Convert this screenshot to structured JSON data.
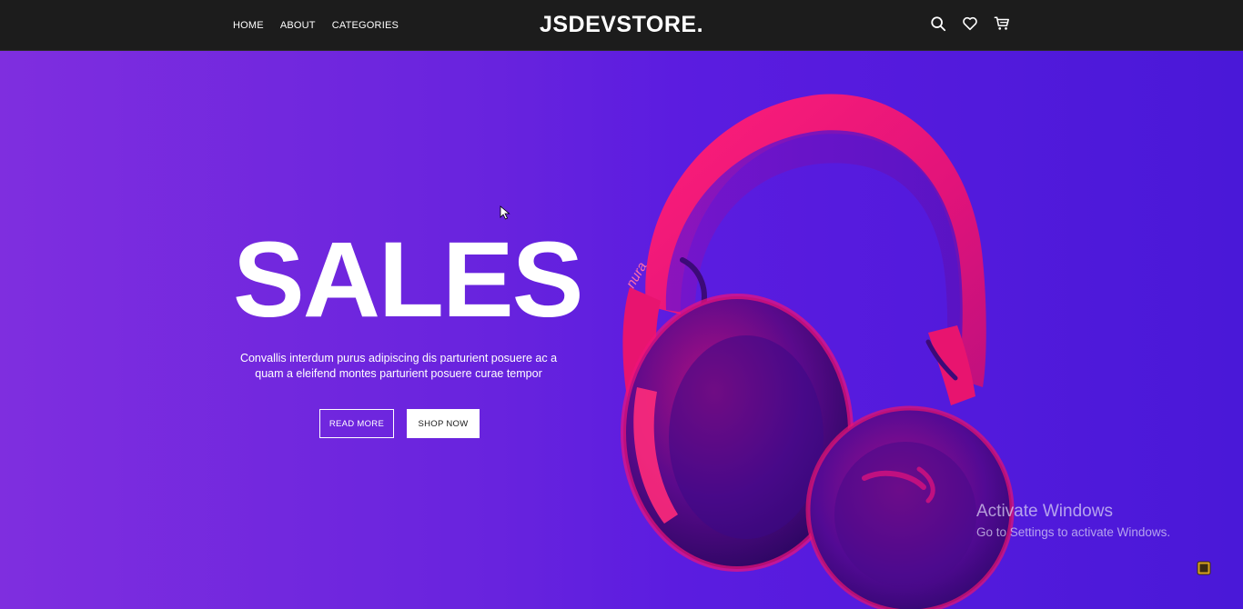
{
  "header": {
    "nav": [
      {
        "label": "HOME"
      },
      {
        "label": "ABOUT"
      },
      {
        "label": "CATEGORIES"
      }
    ],
    "logo": "JSDEVSTORE.",
    "icons": [
      "search-icon",
      "heart-icon",
      "cart-icon"
    ]
  },
  "hero": {
    "title": "SALES",
    "description_line1": "Convallis interdum purus adipiscing dis parturient posuere ac a",
    "description_line2": "quam a eleifend montes parturient posuere curae tempor",
    "read_more_label": "READ MORE",
    "shop_now_label": "SHOP NOW",
    "product_image": "pink-headphones",
    "product_brand_text": "nura"
  },
  "overlay": {
    "activate_title": "Activate Windows",
    "activate_subtitle": "Go to Settings to activate Windows."
  },
  "colors": {
    "header_bg": "#1c1c1c",
    "hero_gradient_start": "#7f2edf",
    "hero_gradient_end": "#4a18d8",
    "headphone_pink": "#e8146f",
    "text": "#ffffff"
  }
}
